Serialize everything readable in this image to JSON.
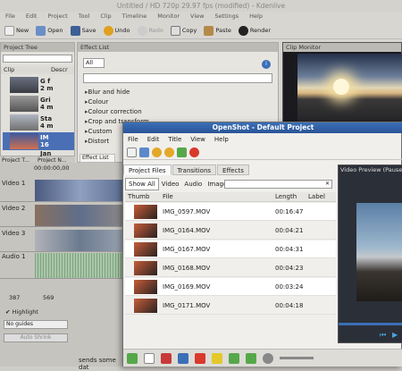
{
  "kdenlive": {
    "title": "Untitled / HD 720p 29.97 fps (modified) - Kdenlive",
    "menu": [
      "File",
      "Edit",
      "Project",
      "Tool",
      "Clip",
      "Timeline",
      "Monitor",
      "View",
      "Settings",
      "Help"
    ],
    "toolbar": [
      "New",
      "Open",
      "Save",
      "Undo",
      "Redo",
      "Copy",
      "Paste",
      "Render"
    ],
    "project_tree": {
      "header": "Project Tree",
      "clip_col": "Clip",
      "desc_col": "Descr",
      "rows": [
        "G f\n2 m",
        "Gri\n4 m",
        "Sta\n4 m",
        "IM\n16",
        "Jan"
      ]
    },
    "effect_list": {
      "header": "Effect List",
      "filter": "All",
      "items": [
        "Blur and hide",
        "Colour",
        "Colour correction",
        "Crop and transform",
        "Custom",
        "Distort"
      ]
    },
    "clip_monitor": {
      "header": "Clip Monitor"
    },
    "tabs": [
      "Project T...",
      "Project N...",
      "Effect List"
    ],
    "timecode": "00:00:00,00",
    "tracks": [
      "Video 1",
      "Video 2",
      "Video 3",
      "Audio 1"
    ],
    "snippet": "sends some dat",
    "bottom": {
      "a": "387",
      "b": "569",
      "highlight": "Highlight",
      "guides": "No guides",
      "btn": "Auto Shrink"
    }
  },
  "openshot": {
    "title": "OpenShot - Default Project",
    "menu": [
      "File",
      "Edit",
      "Title",
      "View",
      "Help"
    ],
    "tabs": [
      "Project Files",
      "Transitions",
      "Effects"
    ],
    "filters": [
      "Show All",
      "Video",
      "Audio",
      "Image"
    ],
    "columns": [
      "Thumb",
      "File",
      "Length",
      "Label"
    ],
    "files": [
      {
        "name": "IMG_0597.MOV",
        "length": "00:16:47"
      },
      {
        "name": "IMG_0164.MOV",
        "length": "00:04:21"
      },
      {
        "name": "IMG_0167.MOV",
        "length": "00:04:31"
      },
      {
        "name": "IMG_0168.MOV",
        "length": "00:04:23"
      },
      {
        "name": "IMG_0169.MOV",
        "length": "00:03:24"
      },
      {
        "name": "IMG_0171.MOV",
        "length": "00:04:18"
      }
    ],
    "preview_label": "Video Preview (Pause"
  }
}
